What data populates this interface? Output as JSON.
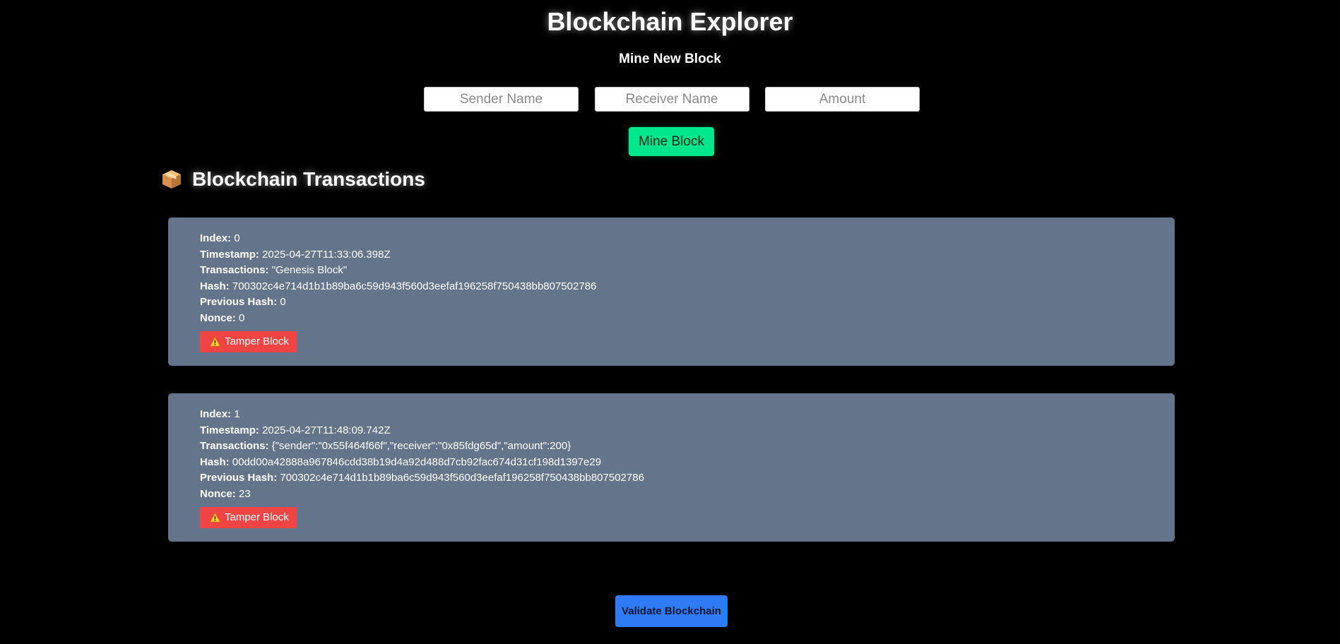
{
  "header": {
    "title": "Blockchain Explorer",
    "subtitle": "Mine New Block"
  },
  "form": {
    "sender_placeholder": "Sender Name",
    "receiver_placeholder": "Receiver Name",
    "amount_placeholder": "Amount",
    "sender_value": "",
    "receiver_value": "",
    "amount_value": "",
    "mine_button": "Mine Block"
  },
  "chain_section": {
    "icon": "package-icon",
    "heading": "Blockchain Transactions"
  },
  "labels": {
    "index": "Index:",
    "timestamp": "Timestamp:",
    "transactions": "Transactions:",
    "hash": "Hash:",
    "previous_hash": "Previous Hash:",
    "nonce": "Nonce:"
  },
  "blocks": [
    {
      "index": "0",
      "timestamp": "2025-04-27T11:33:06.398Z",
      "transactions": "\"Genesis Block\"",
      "hash": "700302c4e714d1b1b89ba6c59d943f560d3eefaf196258f750438bb807502786",
      "previous_hash": "0",
      "nonce": "0",
      "tamper_icon": "warning-icon",
      "tamper_label": "Tamper Block"
    },
    {
      "index": "1",
      "timestamp": "2025-04-27T11:48:09.742Z",
      "transactions": "{\"sender\":\"0x55f464f66f\",\"receiver\":\"0x85fdg65d\",\"amount\":200}",
      "hash": "00dd00a42888a967846cdd38b19d4a92d488d7cb92fac674d31cf198d1397e29",
      "previous_hash": "700302c4e714d1b1b89ba6c59d943f560d3eefaf196258f750438bb807502786",
      "nonce": "23",
      "tamper_icon": "warning-icon",
      "tamper_label": "Tamper Block"
    }
  ],
  "footer": {
    "validate_button": "Validate Blockchain"
  },
  "colors": {
    "background": "#000000",
    "block_card": "#64748b",
    "mine_button": "#00e68c",
    "tamper_button": "#ef4444",
    "validate_button": "#2f7bf6"
  }
}
